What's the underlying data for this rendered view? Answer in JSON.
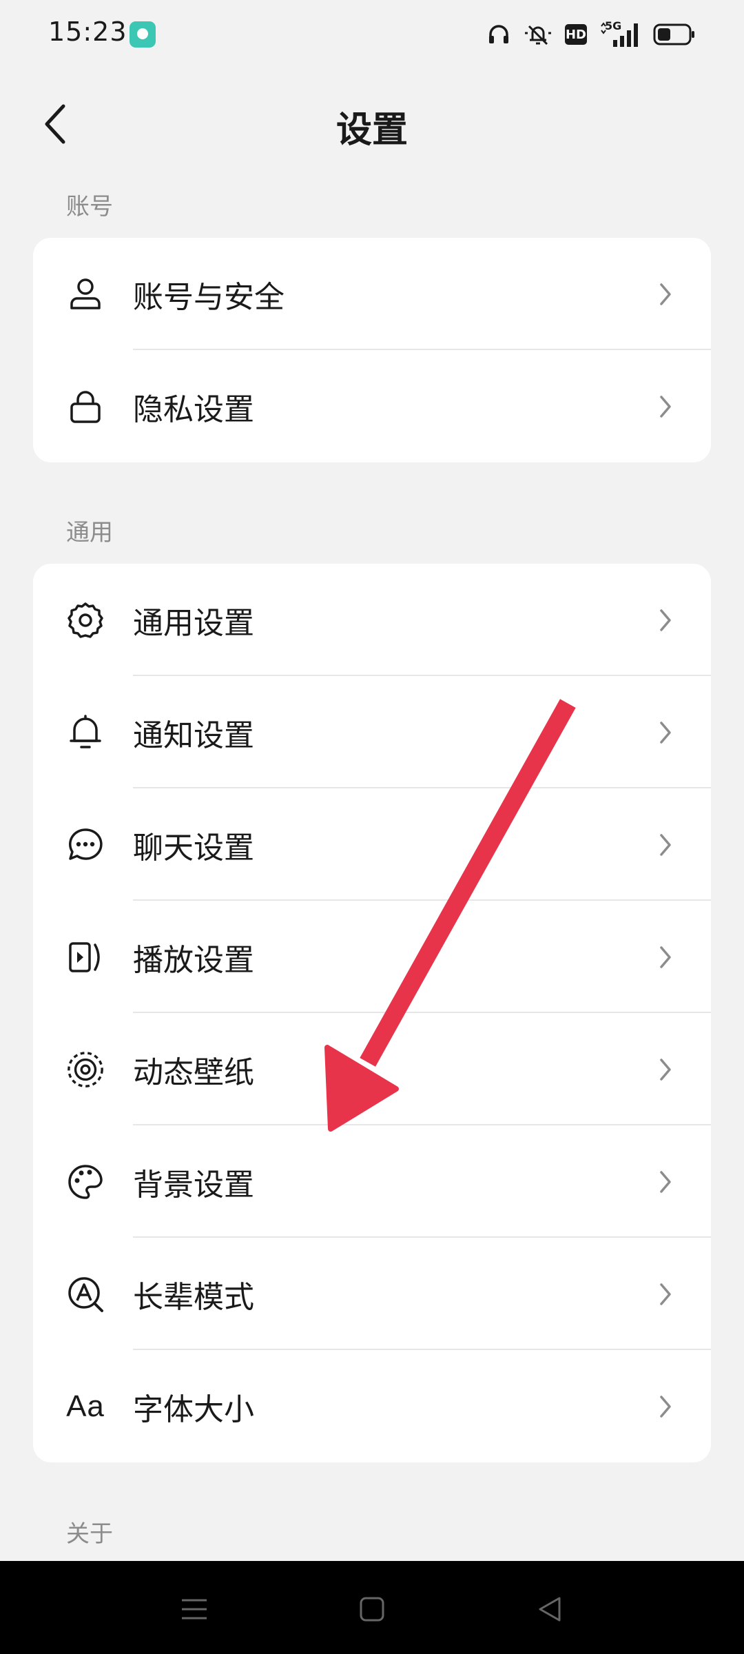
{
  "status_bar": {
    "time": "15:23",
    "icons": [
      "app-notification-icon",
      "headphones-icon",
      "mute-bell-icon",
      "hd-badge",
      "5g-signal-icon",
      "battery-icon"
    ],
    "hd_label": "HD",
    "network_label": "5G"
  },
  "header": {
    "title": "设置",
    "back_icon": "chevron-left-icon"
  },
  "sections": {
    "account": {
      "label": "账号",
      "items": [
        {
          "label": "账号与安全",
          "icon": "person-icon"
        },
        {
          "label": "隐私设置",
          "icon": "lock-icon"
        }
      ]
    },
    "general": {
      "label": "通用",
      "items": [
        {
          "label": "通用设置",
          "icon": "gear-icon"
        },
        {
          "label": "通知设置",
          "icon": "bell-icon"
        },
        {
          "label": "聊天设置",
          "icon": "chat-bubble-icon"
        },
        {
          "label": "播放设置",
          "icon": "play-icon"
        },
        {
          "label": "动态壁纸",
          "icon": "target-icon"
        },
        {
          "label": "背景设置",
          "icon": "palette-icon"
        },
        {
          "label": "长辈模式",
          "icon": "elder-mode-icon"
        },
        {
          "label": "字体大小",
          "icon": "font-size-icon",
          "icon_text": "Aa"
        }
      ]
    },
    "about": {
      "label": "关于"
    }
  },
  "annotation": {
    "arrow_color": "#e8344a"
  },
  "nav_bar": {
    "buttons": [
      "menu-icon",
      "home-square-icon",
      "back-triangle-icon"
    ]
  }
}
